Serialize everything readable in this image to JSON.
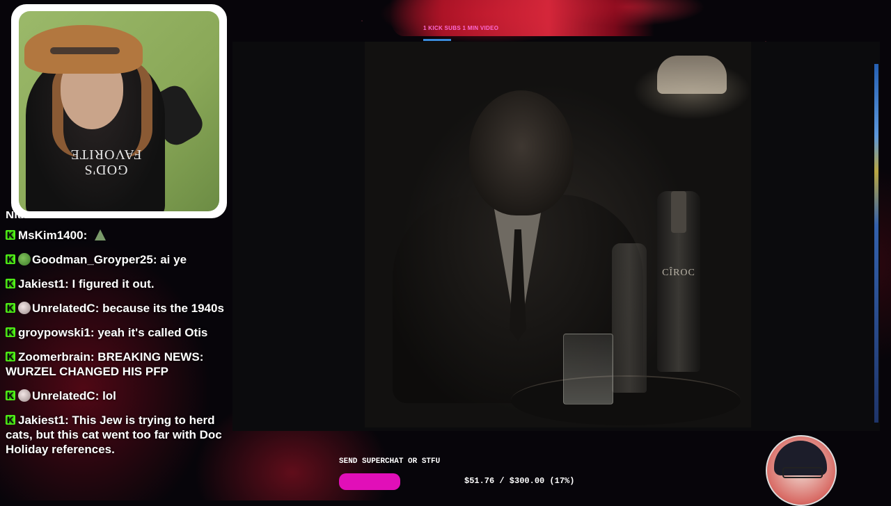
{
  "top_banner": {
    "text": "1 KICK SUBS 1 MIN VIDEO"
  },
  "stream_image": {
    "bottle_label": "CÎROC"
  },
  "webcam": {
    "shirt_text": "GOD'S FAVORITE"
  },
  "chat": {
    "partial_message": "Nick jokes about a lot of things.",
    "messages": [
      {
        "user": "MsKim1400",
        "emote": "tree",
        "text": ""
      },
      {
        "user": "Goodman_Groyper25",
        "emote": "frog",
        "text": "ai ye"
      },
      {
        "user": "Jakiest1",
        "emote": "",
        "text": "I figured it out."
      },
      {
        "user": "UnrelatedC",
        "emote": "rat",
        "text": "because its the 1940s"
      },
      {
        "user": "groypowski1",
        "emote": "",
        "text": "yeah it's called Otis"
      },
      {
        "user": "Zoomerbrain",
        "emote": "",
        "text": "BREAKING NEWS: WURZEL CHANGED HIS PFP"
      },
      {
        "user": "UnrelatedC",
        "emote": "rat",
        "text": "lol"
      },
      {
        "user": "Jakiest1",
        "emote": "",
        "text": "This Jew is trying to herd cats, but this cat went too far with Doc Holiday references."
      }
    ]
  },
  "goal": {
    "label": "SEND SUPERCHAT OR STFU",
    "amount_text": "$51.76 / $300.00 (17%)",
    "progress": 0.17,
    "bar_color": "#e10fb8"
  },
  "colors": {
    "kick_green": "#53fc18",
    "banner_red": "#c8142a"
  }
}
